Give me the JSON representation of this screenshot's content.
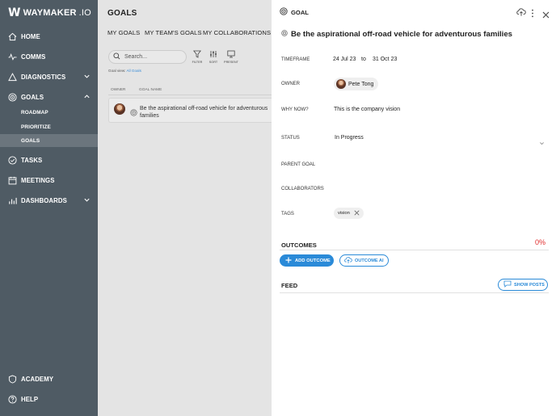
{
  "app": {
    "logo_text": "WAYMAKER",
    "logo_suffix": ".IO"
  },
  "sidebar": {
    "items": [
      {
        "label": "HOME"
      },
      {
        "label": "COMMS"
      },
      {
        "label": "DIAGNOSTICS"
      },
      {
        "label": "GOALS"
      },
      {
        "label": "ROADMAP"
      },
      {
        "label": "PRIORITIZE"
      },
      {
        "label": "GOALS"
      },
      {
        "label": "TASKS"
      },
      {
        "label": "MEETINGS"
      },
      {
        "label": "DASHBOARDS"
      },
      {
        "label": "ACADEMY"
      },
      {
        "label": "HELP"
      }
    ]
  },
  "goals_list": {
    "title": "GOALS",
    "tabs": [
      "MY GOALS",
      "MY TEAM'S GOALS",
      "MY COLLABORATIONS"
    ],
    "search_placeholder": "Search...",
    "tools": [
      "FILTER",
      "SORT",
      "PRESENT"
    ],
    "goal_view_label": "Goal view:",
    "goal_view_value": "All Goals",
    "columns": [
      "OWNER",
      "GOAL NAME"
    ],
    "rows": [
      {
        "name": "Be the aspirational off-road vehicle for adventurous families"
      }
    ]
  },
  "detail": {
    "header": "GOAL",
    "title": "Be the aspirational off-road vehicle for adventurous families",
    "fields": {
      "timeframe_label": "TIMEFRAME",
      "start": "24 Jul 23",
      "to": "to",
      "end": "31 Oct 23",
      "owner_label": "OWNER",
      "owner": "Pete Tong",
      "why_label": "WHY NOW?",
      "why": "This is the company vision",
      "status_label": "STATUS",
      "status": "In Progress",
      "parent_label": "PARENT GOAL",
      "collab_label": "COLLABORATORS",
      "tags_label": "TAGS",
      "tag": "vision"
    },
    "outcomes_label": "OUTCOMES",
    "outcomes_pct": "0%",
    "add_outcome": "ADD OUTCOME",
    "outcome_ai": "OUTCOME AI",
    "feed_label": "FEED",
    "show_posts": "SHOW POSTS"
  },
  "colors": {
    "sidebar": "#4f5b64",
    "accent": "#2a8ad8",
    "danger": "#e02b2b"
  }
}
